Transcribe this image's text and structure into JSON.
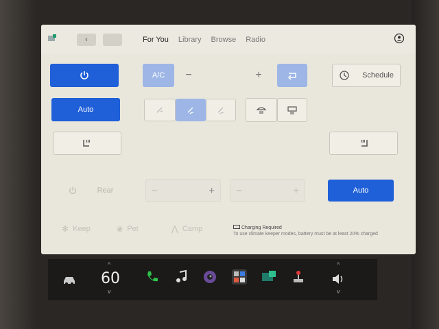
{
  "topbar": {
    "tabs": [
      "For You",
      "Library",
      "Browse",
      "Radio"
    ],
    "back_icon": "‹"
  },
  "climate": {
    "ac_label": "A/C",
    "minus": "−",
    "plus": "+",
    "schedule_label": "Schedule",
    "auto_label": "Auto"
  },
  "rear": {
    "label": "Rear",
    "auto_label": "Auto",
    "minus": "−",
    "plus": "+"
  },
  "modes": {
    "keep": "Keep",
    "pet": "Pet",
    "camp": "Camp",
    "charging_title": "Charging Required",
    "charging_desc": "To use climate keeper modes, battery must be at least 20% charged"
  },
  "dock": {
    "temperature": "60",
    "up": "^",
    "down": "v"
  },
  "colors": {
    "accent": "#1f5fd8",
    "accent_light": "#9db6e6"
  }
}
